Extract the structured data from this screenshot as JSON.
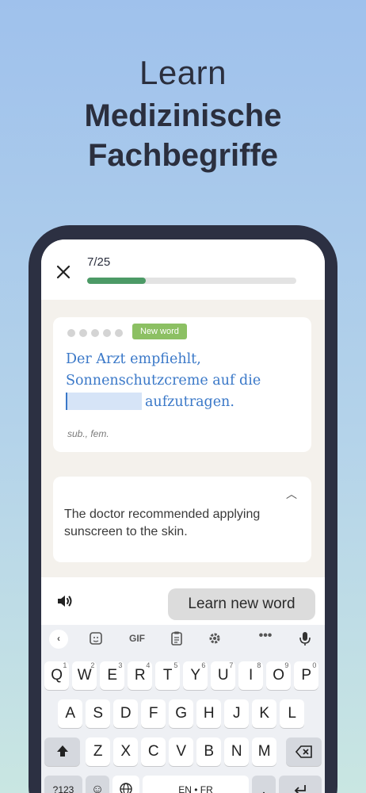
{
  "headline": {
    "line1": "Learn",
    "line2": "Medizinische",
    "line3": "Fachbegriffe"
  },
  "lesson": {
    "counter": "7/25",
    "progress_fraction": 0.28,
    "badge": "New word",
    "sentence_part1": "Der Arzt empfiehlt, Sonnenschutzcreme auf die",
    "sentence_part2": "aufzutragen.",
    "part_of_speech": "sub., fem.",
    "translation": "The doctor recommended applying sunscreen to the skin.",
    "learn_button": "Learn new word"
  },
  "keyboard": {
    "toolbar_gif": "GIF",
    "row1": [
      {
        "key": "Q",
        "num": "1"
      },
      {
        "key": "W",
        "num": "2"
      },
      {
        "key": "E",
        "num": "3"
      },
      {
        "key": "R",
        "num": "4"
      },
      {
        "key": "T",
        "num": "5"
      },
      {
        "key": "Y",
        "num": "6"
      },
      {
        "key": "U",
        "num": "7"
      },
      {
        "key": "I",
        "num": "8"
      },
      {
        "key": "O",
        "num": "9"
      },
      {
        "key": "P",
        "num": "0"
      }
    ],
    "row2": [
      "A",
      "S",
      "D",
      "F",
      "G",
      "H",
      "J",
      "K",
      "L"
    ],
    "row3": [
      "Z",
      "X",
      "C",
      "V",
      "B",
      "N",
      "M"
    ],
    "symbols_key": "?123",
    "emoji_key": "☺",
    "space_label": "EN • FR"
  },
  "icons": {
    "close": "close-icon",
    "speaker": "speaker-icon",
    "collapse": "chevron-up-icon"
  },
  "colors": {
    "progress": "#4c9a66",
    "badge": "#8cc063",
    "sentence": "#3a78c8"
  }
}
